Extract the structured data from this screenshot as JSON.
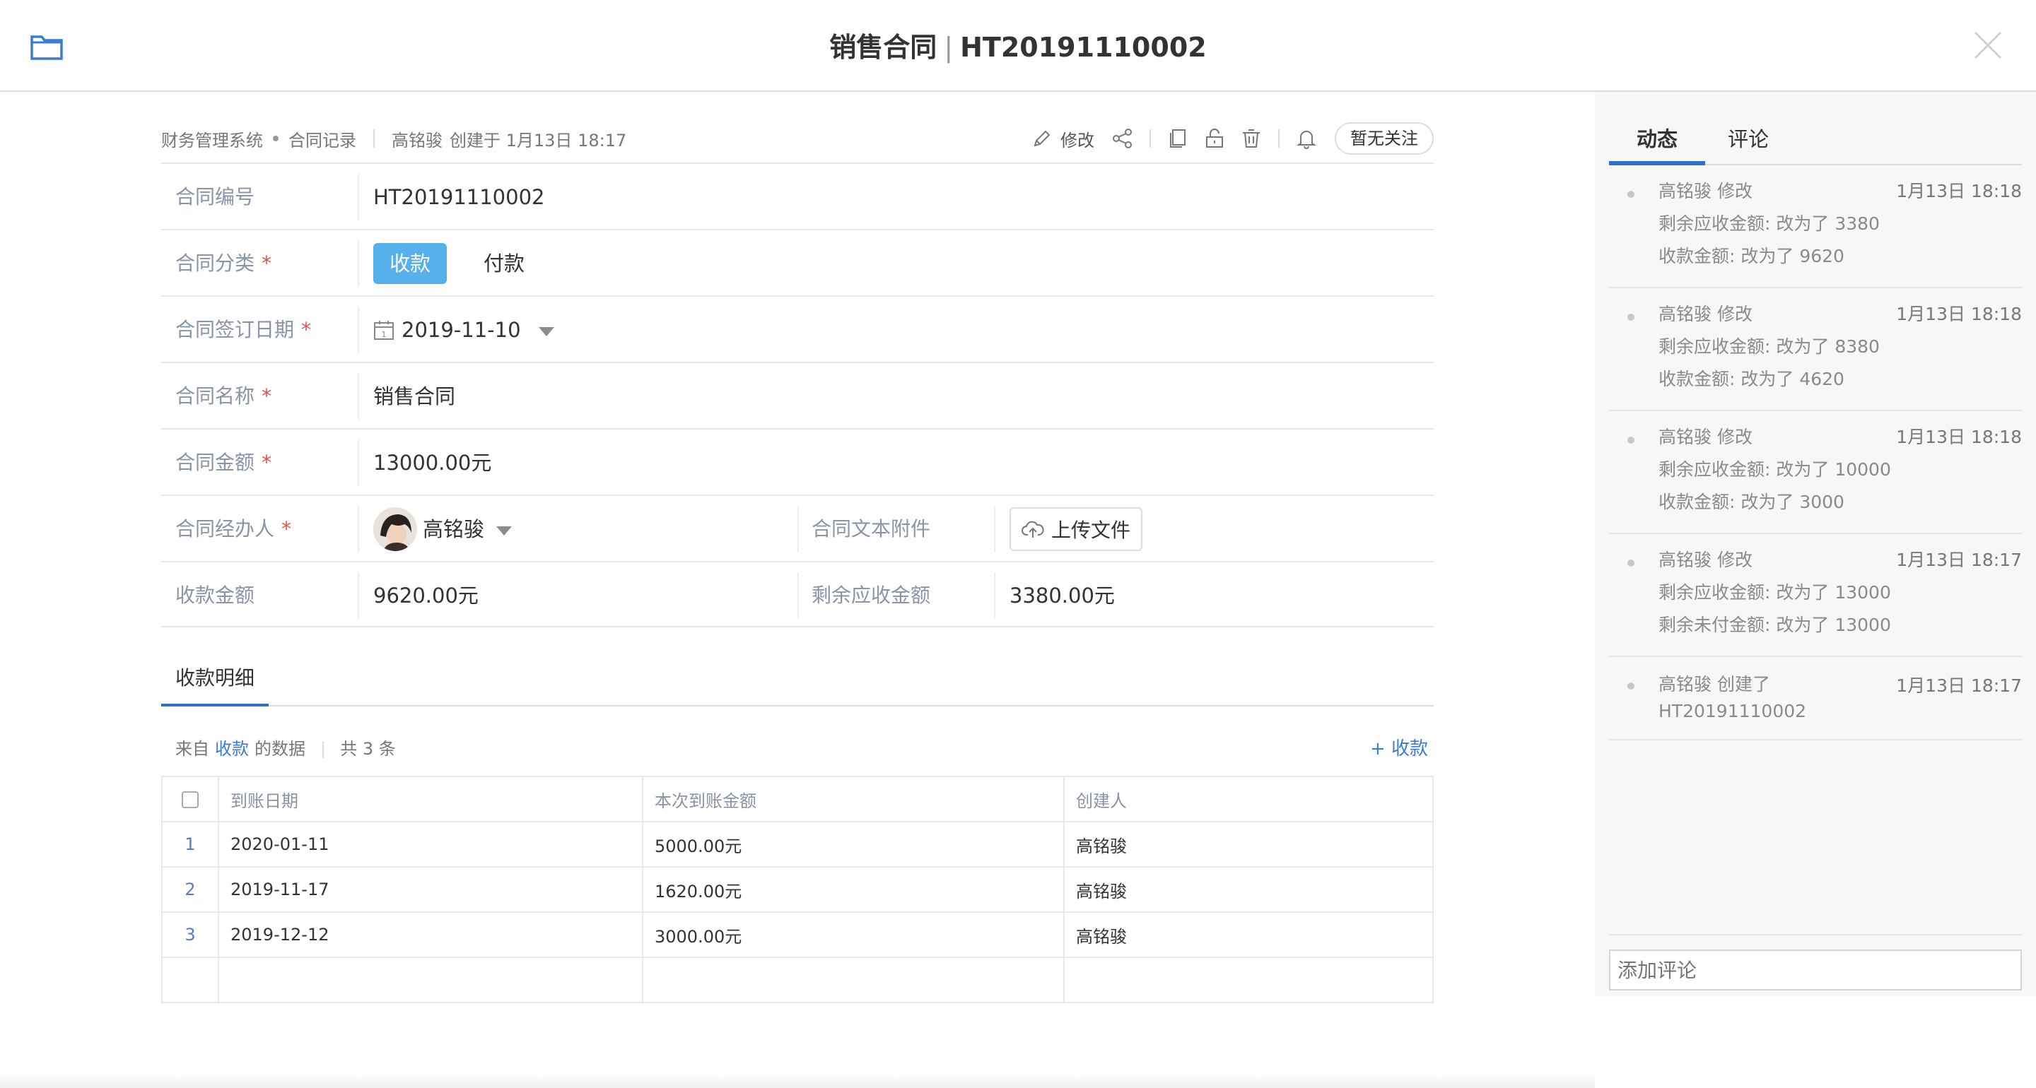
{
  "window": {
    "title_main": "销售合同",
    "title_sep": "|",
    "title_code": "HT20191110002"
  },
  "meta": {
    "system": "财务管理系统",
    "module": "合同记录",
    "creator": "高铭骏",
    "created_label": "创建于 1月13日 18:17",
    "edit_label": "修改",
    "follow_label": "暂无关注"
  },
  "form": {
    "contract_no": {
      "label": "合同编号",
      "value": "HT20191110002"
    },
    "category": {
      "label": "合同分类",
      "required": "*",
      "option_selected": "收款",
      "option_other": "付款"
    },
    "sign_date": {
      "label": "合同签订日期",
      "required": "*",
      "value": "2019-11-10"
    },
    "name": {
      "label": "合同名称",
      "required": "*",
      "value": "销售合同"
    },
    "amount": {
      "label": "合同金额",
      "required": "*",
      "value": "13000.00元"
    },
    "handler": {
      "label": "合同经办人",
      "required": "*",
      "value": "高铭骏"
    },
    "attachment": {
      "label": "合同文本附件",
      "button": "上传文件"
    },
    "received": {
      "label": "收款金额",
      "value": "9620.00元"
    },
    "remaining": {
      "label": "剩余应收金额",
      "value": "3380.00元"
    }
  },
  "detail": {
    "tab_label": "收款明细",
    "source_prefix": "来自",
    "source_link": "收款",
    "source_suffix": "的数据",
    "count": "共 3 条",
    "add_label": "+ 收款",
    "columns": [
      "到账日期",
      "本次到账金额",
      "创建人"
    ],
    "rows": [
      {
        "idx": "1",
        "date": "2020-01-11",
        "amount": "5000.00元",
        "creator": "高铭骏"
      },
      {
        "idx": "2",
        "date": "2019-11-17",
        "amount": "1620.00元",
        "creator": "高铭骏"
      },
      {
        "idx": "3",
        "date": "2019-12-12",
        "amount": "3000.00元",
        "creator": "高铭骏"
      }
    ]
  },
  "sidebar": {
    "tab_activity": "动态",
    "tab_comments": "评论",
    "feed": [
      {
        "title": "高铭骏 修改",
        "time": "1月13日 18:18",
        "line1": "剩余应收金额: 改为了 3380",
        "line2": "收款金额: 改为了 9620"
      },
      {
        "title": "高铭骏 修改",
        "time": "1月13日 18:18",
        "line1": "剩余应收金额: 改为了 8380",
        "line2": "收款金额: 改为了 4620"
      },
      {
        "title": "高铭骏 修改",
        "time": "1月13日 18:18",
        "line1": "剩余应收金额: 改为了 10000",
        "line2": "收款金额: 改为了 3000"
      },
      {
        "title": "高铭骏 修改",
        "time": "1月13日 18:17",
        "line1": "剩余应收金额: 改为了 13000",
        "line2": "剩余未付金额: 改为了 13000"
      },
      {
        "title": "高铭骏 创建了",
        "time": "1月13日 18:17",
        "line1": "HT20191110002",
        "line2": ""
      }
    ],
    "comment_placeholder": "添加评论"
  },
  "colors": {
    "accent": "#2f6fd0",
    "selected_button": "#55b0ec",
    "required": "#e0524c",
    "label": "#8a94a6"
  }
}
